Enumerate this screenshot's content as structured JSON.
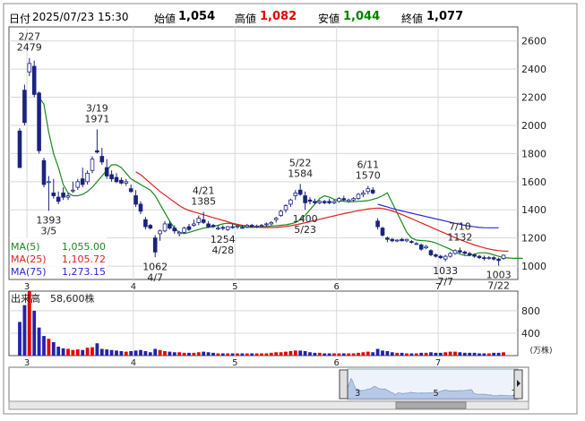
{
  "header": {
    "date_label": "日付",
    "datetime": "2025/07/23 15:30",
    "open_label": "始値",
    "open_value": "1,054",
    "high_label": "高値",
    "high_value": "1,082",
    "low_label": "安値",
    "low_value": "1,044",
    "close_label": "終値",
    "close_value": "1,077",
    "high_color": "#e60000",
    "low_color": "#008000"
  },
  "ma_legend": [
    {
      "label": "MA(5)",
      "value": "1,055.00",
      "color": "#1a8a1a"
    },
    {
      "label": "MA(25)",
      "value": "1,105.72",
      "color": "#e02020"
    },
    {
      "label": "MA(75)",
      "value": "1,273.15",
      "color": "#2a2ad0"
    }
  ],
  "volume_legend": {
    "label": "出来高",
    "value": "58,600株",
    "unit": "(万株)"
  },
  "navigator": {
    "ticks": [
      "3",
      "5",
      "7"
    ]
  },
  "chart_data": [
    {
      "type": "candlestick",
      "title": "",
      "x_tick_labels": [
        "3",
        "4",
        "5",
        "6",
        "7"
      ],
      "y_ticks": [
        1000,
        1200,
        1400,
        1600,
        1800,
        2000,
        2200,
        2400,
        2600
      ],
      "ylim": [
        905,
        2700
      ],
      "grid": true,
      "annotations": [
        {
          "text": [
            "2/27",
            "2479"
          ],
          "index": 2,
          "value": 2479,
          "kind": "high"
        },
        {
          "text": [
            "1393",
            "3/5"
          ],
          "index": 6,
          "value": 1393,
          "kind": "low"
        },
        {
          "text": [
            "3/19",
            "1971"
          ],
          "index": 16,
          "value": 1971,
          "kind": "high"
        },
        {
          "text": [
            "1062",
            "4/7"
          ],
          "index": 28,
          "value": 1062,
          "kind": "low"
        },
        {
          "text": [
            "4/21",
            "1385"
          ],
          "index": 38,
          "value": 1385,
          "kind": "high"
        },
        {
          "text": [
            "1254",
            "4/28"
          ],
          "index": 42,
          "value": 1254,
          "kind": "low"
        },
        {
          "text": [
            "5/22",
            "1584"
          ],
          "index": 58,
          "value": 1584,
          "kind": "high"
        },
        {
          "text": [
            "1400",
            "5/23"
          ],
          "index": 59,
          "value": 1400,
          "kind": "low"
        },
        {
          "text": [
            "6/11",
            "1570"
          ],
          "index": 72,
          "value": 1570,
          "kind": "high"
        },
        {
          "text": [
            "7/10",
            "1132"
          ],
          "index": 91,
          "value": 1132,
          "kind": "high"
        },
        {
          "text": [
            "1033",
            "7/7"
          ],
          "index": 88,
          "value": 1033,
          "kind": "low"
        },
        {
          "text": [
            "1003",
            "7/22"
          ],
          "index": 99,
          "value": 1003,
          "kind": "low"
        }
      ],
      "candles": [
        [
          1960,
          1980,
          1700,
          1700
        ],
        [
          2250,
          2290,
          2000,
          2020
        ],
        [
          2380,
          2479,
          2350,
          2440
        ],
        [
          2420,
          2460,
          2200,
          2220
        ],
        [
          2230,
          2240,
          1800,
          1820
        ],
        [
          1750,
          1770,
          1560,
          1580
        ],
        [
          1600,
          1640,
          1393,
          1600
        ],
        [
          1520,
          1620,
          1480,
          1500
        ],
        [
          1490,
          1530,
          1440,
          1460
        ],
        [
          1520,
          1560,
          1470,
          1490
        ],
        [
          1490,
          1520,
          1470,
          1500
        ],
        [
          1540,
          1600,
          1520,
          1540
        ],
        [
          1560,
          1620,
          1540,
          1600
        ],
        [
          1620,
          1700,
          1560,
          1580
        ],
        [
          1600,
          1680,
          1580,
          1660
        ],
        [
          1680,
          1780,
          1660,
          1760
        ],
        [
          1820,
          1971,
          1800,
          1810
        ],
        [
          1780,
          1840,
          1720,
          1740
        ],
        [
          1700,
          1760,
          1620,
          1640
        ],
        [
          1650,
          1680,
          1600,
          1620
        ],
        [
          1630,
          1660,
          1590,
          1600
        ],
        [
          1610,
          1630,
          1580,
          1590
        ],
        [
          1590,
          1620,
          1570,
          1600
        ],
        [
          1550,
          1580,
          1520,
          1530
        ],
        [
          1500,
          1540,
          1420,
          1440
        ],
        [
          1440,
          1460,
          1370,
          1390
        ],
        [
          1330,
          1350,
          1260,
          1280
        ],
        [
          1290,
          1300,
          1260,
          1270
        ],
        [
          1200,
          1220,
          1062,
          1100
        ],
        [
          1230,
          1260,
          1180,
          1250
        ],
        [
          1250,
          1320,
          1240,
          1300
        ],
        [
          1300,
          1320,
          1260,
          1270
        ],
        [
          1270,
          1290,
          1230,
          1250
        ],
        [
          1230,
          1250,
          1210,
          1240
        ],
        [
          1240,
          1280,
          1230,
          1270
        ],
        [
          1280,
          1300,
          1250,
          1260
        ],
        [
          1290,
          1330,
          1280,
          1300
        ],
        [
          1310,
          1360,
          1290,
          1340
        ],
        [
          1330,
          1385,
          1300,
          1310
        ],
        [
          1300,
          1320,
          1270,
          1280
        ],
        [
          1290,
          1300,
          1270,
          1280
        ],
        [
          1270,
          1290,
          1256,
          1270
        ],
        [
          1275,
          1290,
          1254,
          1270
        ],
        [
          1260,
          1285,
          1250,
          1280
        ],
        [
          1280,
          1300,
          1265,
          1275
        ],
        [
          1280,
          1290,
          1265,
          1285
        ],
        [
          1275,
          1290,
          1265,
          1270
        ],
        [
          1280,
          1300,
          1270,
          1290
        ],
        [
          1290,
          1300,
          1275,
          1280
        ],
        [
          1280,
          1295,
          1270,
          1285
        ],
        [
          1285,
          1300,
          1275,
          1290
        ],
        [
          1295,
          1310,
          1280,
          1300
        ],
        [
          1300,
          1320,
          1290,
          1310
        ],
        [
          1330,
          1350,
          1310,
          1340
        ],
        [
          1360,
          1400,
          1350,
          1390
        ],
        [
          1400,
          1440,
          1380,
          1430
        ],
        [
          1440,
          1480,
          1420,
          1470
        ],
        [
          1500,
          1540,
          1470,
          1520
        ],
        [
          1540,
          1584,
          1500,
          1510
        ],
        [
          1500,
          1530,
          1400,
          1450
        ],
        [
          1470,
          1490,
          1440,
          1460
        ],
        [
          1460,
          1480,
          1440,
          1450
        ],
        [
          1450,
          1470,
          1440,
          1460
        ],
        [
          1460,
          1470,
          1440,
          1450
        ],
        [
          1460,
          1480,
          1440,
          1450
        ],
        [
          1450,
          1470,
          1440,
          1460
        ],
        [
          1460,
          1490,
          1450,
          1480
        ],
        [
          1480,
          1500,
          1460,
          1470
        ],
        [
          1460,
          1480,
          1450,
          1470
        ],
        [
          1470,
          1490,
          1460,
          1480
        ],
        [
          1480,
          1520,
          1470,
          1510
        ],
        [
          1510,
          1540,
          1490,
          1520
        ],
        [
          1530,
          1570,
          1510,
          1550
        ],
        [
          1540,
          1560,
          1510,
          1520
        ],
        [
          1320,
          1340,
          1260,
          1280
        ],
        [
          1270,
          1280,
          1210,
          1220
        ],
        [
          1200,
          1210,
          1170,
          1190
        ],
        [
          1190,
          1200,
          1170,
          1180
        ],
        [
          1180,
          1190,
          1170,
          1185
        ],
        [
          1190,
          1200,
          1175,
          1180
        ],
        [
          1180,
          1195,
          1170,
          1190
        ],
        [
          1175,
          1185,
          1160,
          1170
        ],
        [
          1160,
          1170,
          1150,
          1160
        ],
        [
          1150,
          1160,
          1110,
          1120
        ],
        [
          1130,
          1150,
          1120,
          1140
        ],
        [
          1110,
          1120,
          1070,
          1080
        ],
        [
          1080,
          1090,
          1060,
          1070
        ],
        [
          1070,
          1080,
          1050,
          1060
        ],
        [
          1050,
          1080,
          1033,
          1070
        ],
        [
          1070,
          1100,
          1060,
          1090
        ],
        [
          1090,
          1120,
          1080,
          1110
        ],
        [
          1110,
          1132,
          1090,
          1100
        ],
        [
          1100,
          1110,
          1080,
          1090
        ],
        [
          1090,
          1100,
          1070,
          1080
        ],
        [
          1080,
          1090,
          1060,
          1070
        ],
        [
          1070,
          1080,
          1050,
          1060
        ],
        [
          1060,
          1075,
          1040,
          1055
        ],
        [
          1055,
          1070,
          1045,
          1060
        ],
        [
          1060,
          1070,
          1040,
          1050
        ],
        [
          1050,
          1060,
          1003,
          1040
        ],
        [
          1054,
          1082,
          1044,
          1077
        ]
      ],
      "month_starts": [
        {
          "label": "3",
          "index": 2
        },
        {
          "label": "4",
          "index": 24
        },
        {
          "label": "5",
          "index": 45
        },
        {
          "label": "6",
          "index": 66
        },
        {
          "label": "7",
          "index": 87
        }
      ],
      "ma": [
        {
          "name": "MA(5)",
          "color": "#1a8a1a",
          "start": 4,
          "values": [
            2200,
            2150,
            1950,
            1800,
            1700,
            1580,
            1520,
            1500,
            1500,
            1510,
            1530,
            1560,
            1600,
            1640,
            1680,
            1720,
            1720,
            1700,
            1660,
            1620,
            1600,
            1580,
            1560,
            1540,
            1500,
            1440,
            1380,
            1320,
            1270,
            1240,
            1230,
            1240,
            1250,
            1260,
            1270,
            1275,
            1280,
            1290,
            1300,
            1305,
            1300,
            1290,
            1282,
            1276,
            1275,
            1278,
            1280,
            1282,
            1285,
            1287,
            1290,
            1293,
            1300,
            1310,
            1330,
            1360,
            1400,
            1440,
            1480,
            1500,
            1490,
            1475,
            1465,
            1460,
            1458,
            1458,
            1460,
            1462,
            1466,
            1474,
            1485,
            1500,
            1520,
            1450,
            1380,
            1310,
            1240,
            1200,
            1185,
            1182,
            1180,
            1175,
            1165,
            1150,
            1135,
            1120,
            1100,
            1085,
            1075,
            1075,
            1085,
            1095,
            1095,
            1090,
            1080,
            1070,
            1060,
            1058,
            1055,
            1055,
            1055
          ]
        },
        {
          "name": "MA(25)",
          "color": "#e02020",
          "start": 24,
          "values": [
            1670,
            1650,
            1620,
            1590,
            1560,
            1530,
            1505,
            1480,
            1455,
            1430,
            1410,
            1395,
            1385,
            1375,
            1365,
            1355,
            1345,
            1335,
            1325,
            1315,
            1305,
            1297,
            1290,
            1285,
            1280,
            1277,
            1275,
            1274,
            1274,
            1275,
            1278,
            1282,
            1287,
            1293,
            1300,
            1308,
            1316,
            1325,
            1333,
            1341,
            1349,
            1357,
            1365,
            1373,
            1380,
            1387,
            1394,
            1400,
            1405,
            1410,
            1412,
            1410,
            1402,
            1392,
            1380,
            1367,
            1352,
            1337,
            1322,
            1307,
            1292,
            1277,
            1262,
            1247,
            1232,
            1217,
            1202,
            1188,
            1175,
            1162,
            1150,
            1140,
            1130,
            1122,
            1115,
            1110,
            1107,
            1106
          ]
        },
        {
          "name": "MA(75)",
          "color": "#2a2ad0",
          "start": 74,
          "values": [
            1440,
            1430,
            1420,
            1410,
            1400,
            1392,
            1384,
            1376,
            1368,
            1360,
            1352,
            1344,
            1336,
            1328,
            1320,
            1312,
            1304,
            1297,
            1290,
            1284,
            1279,
            1275,
            1273,
            1272,
            1272,
            1272
          ]
        }
      ]
    },
    {
      "type": "bar",
      "title": "出来高",
      "unit": "万株",
      "x_tick_labels": [
        "3",
        "4",
        "5",
        "6",
        "7"
      ],
      "y_ticks": [
        400,
        800
      ],
      "ylim": [
        0,
        1150
      ],
      "volume_colors": {
        "up": "#e60000",
        "down": "#2222aa",
        "flat": "#2222aa"
      },
      "values": [
        600,
        900,
        1150,
        800,
        500,
        350,
        300,
        240,
        160,
        130,
        120,
        100,
        110,
        100,
        140,
        150,
        220,
        120,
        110,
        100,
        90,
        80,
        70,
        80,
        90,
        100,
        80,
        60,
        120,
        100,
        80,
        70,
        60,
        60,
        50,
        50,
        50,
        60,
        70,
        60,
        50,
        40,
        40,
        40,
        40,
        40,
        40,
        40,
        40,
        40,
        40,
        40,
        50,
        60,
        60,
        70,
        80,
        90,
        90,
        80,
        60,
        50,
        50,
        40,
        40,
        40,
        40,
        40,
        40,
        40,
        50,
        60,
        70,
        60,
        120,
        90,
        80,
        60,
        50,
        50,
        40,
        40,
        40,
        50,
        50,
        60,
        50,
        50,
        60,
        70,
        70,
        60,
        50,
        50,
        50,
        40,
        40,
        40,
        50,
        50,
        59
      ]
    }
  ]
}
